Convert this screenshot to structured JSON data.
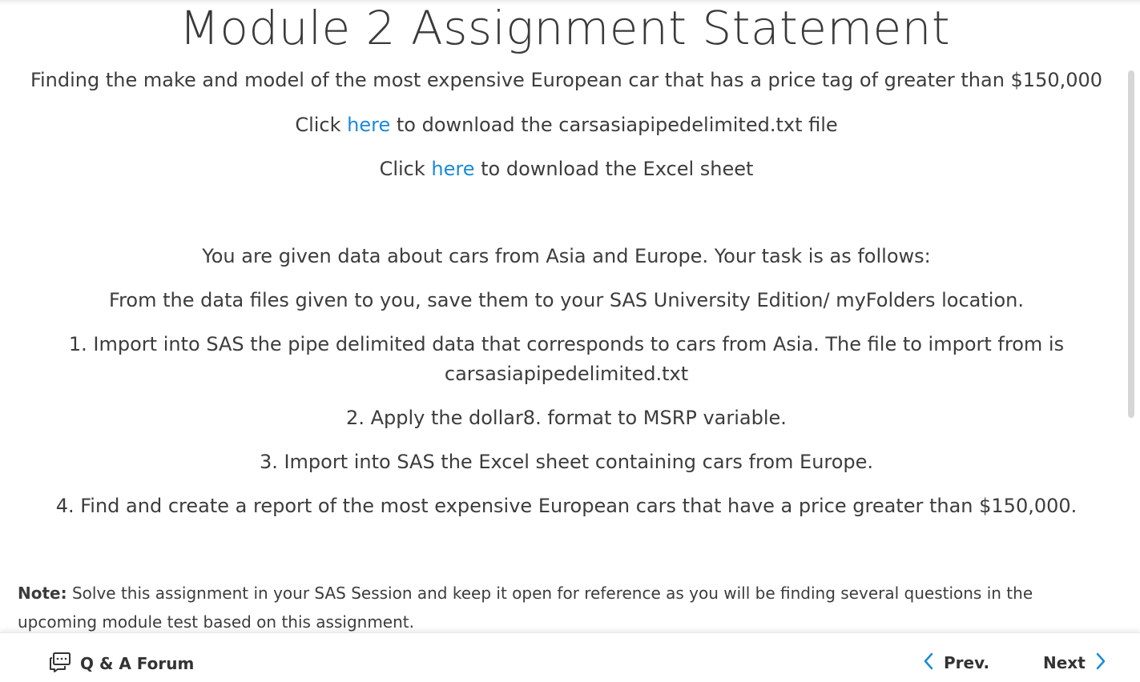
{
  "page": {
    "title": "Module 2 Assignment Statement",
    "subtitle": "Finding the make and model of the most expensive European car that has a price tag of greater than $150,000",
    "downloads": [
      {
        "prefix": "Click ",
        "link": "here",
        "suffix": " to download the carsasiapipedelimited.txt file"
      },
      {
        "prefix": "Click ",
        "link": "here",
        "suffix": " to download the Excel sheet"
      }
    ],
    "intro": "You are given data about cars from Asia and Europe. Your task is as follows:",
    "instruction": "From the data files given to you, save them to your SAS University Edition/ myFolders location.",
    "steps": [
      "1. Import into SAS the pipe delimited data that corresponds to cars from Asia. The file to import from is",
      "carsasiapipedelimited.txt",
      "2. Apply the dollar8. format to MSRP variable.",
      "3. Import into SAS the Excel sheet containing cars from Europe.",
      "4. Find and create a report of the most expensive European cars that have a price greater than $150,000."
    ],
    "note_label": "Note:",
    "note_text": " Solve this assignment in your SAS Session and keep it open for reference as you will be finding several questions in the upcoming module test based on this assignment."
  },
  "footer": {
    "forum_label": "Q & A Forum",
    "forum_icon": "chat-bubbles-icon",
    "prev_label": "Prev.",
    "next_label": "Next",
    "accent_color": "#1a8ad9"
  }
}
